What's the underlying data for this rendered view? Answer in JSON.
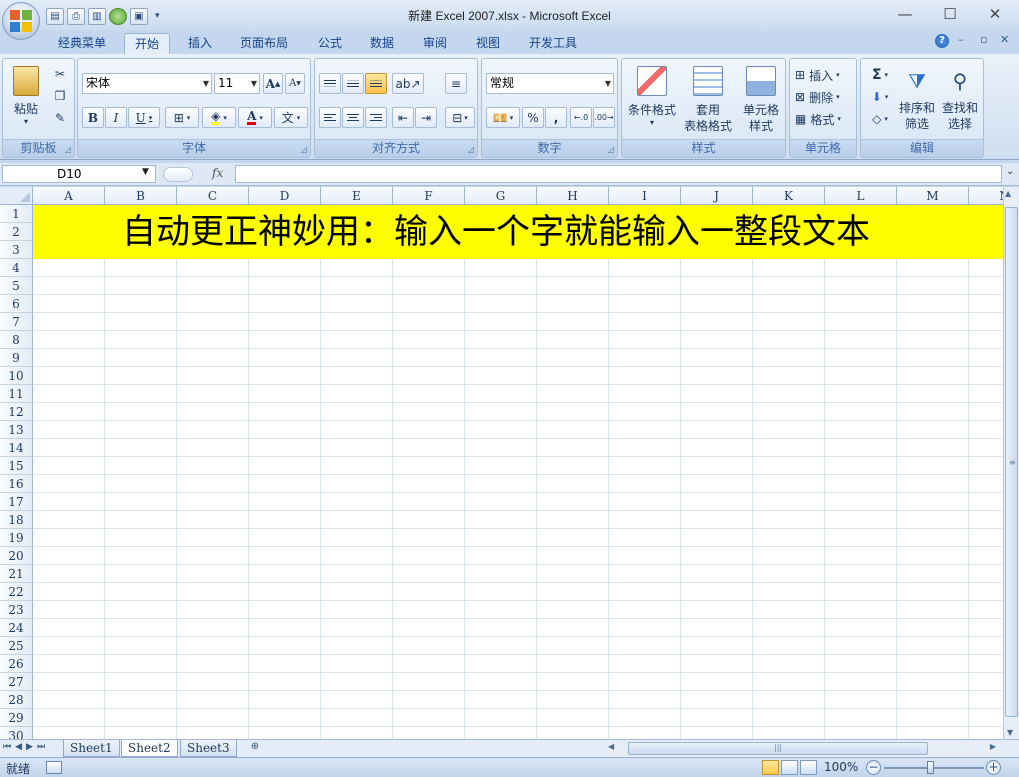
{
  "window": {
    "title": "新建 Excel 2007.xlsx - Microsoft Excel",
    "minimize": "—",
    "maximize": "☐",
    "close": "✕"
  },
  "quick_access": {
    "icons": [
      "print-preview-icon",
      "print-icon",
      "chart-icon",
      "circle-icon",
      "save-icon"
    ],
    "dropdown": "▾"
  },
  "tabs": [
    {
      "label": "经典菜单",
      "active": false
    },
    {
      "label": "开始",
      "active": true
    },
    {
      "label": "插入",
      "active": false
    },
    {
      "label": "页面布局",
      "active": false
    },
    {
      "label": "公式",
      "active": false
    },
    {
      "label": "数据",
      "active": false
    },
    {
      "label": "审阅",
      "active": false
    },
    {
      "label": "视图",
      "active": false
    },
    {
      "label": "开发工具",
      "active": false
    }
  ],
  "ribbon": {
    "clipboard": {
      "label": "剪贴板",
      "paste": "粘贴"
    },
    "font": {
      "label": "字体",
      "font_name": "宋体",
      "font_size": "11",
      "bold": "B",
      "italic": "I",
      "underline": "U",
      "grow": "A",
      "shrink": "A",
      "font_color_letter": "A",
      "phonetic": "文"
    },
    "alignment": {
      "label": "对齐方式"
    },
    "number": {
      "label": "数字",
      "format": "常规",
      "percent": "%",
      "comma": ","
    },
    "styles": {
      "label": "样式",
      "conditional": "条件格式",
      "table_format_1": "套用",
      "table_format_2": "表格格式",
      "cell_styles_1": "单元格",
      "cell_styles_2": "样式"
    },
    "cells": {
      "label": "单元格",
      "insert": "插入",
      "delete": "删除",
      "format": "格式"
    },
    "editing": {
      "label": "编辑",
      "sort_1": "排序和",
      "sort_2": "筛选",
      "find_1": "查找和",
      "find_2": "选择",
      "sum": "Σ"
    }
  },
  "formula_bar": {
    "name_box": "D10",
    "fx": "fx",
    "value": ""
  },
  "grid": {
    "columns": [
      "A",
      "B",
      "C",
      "D",
      "E",
      "F",
      "G",
      "H",
      "I",
      "J",
      "K",
      "L",
      "M",
      "N"
    ],
    "rows": [
      "1",
      "2",
      "3",
      "4",
      "5",
      "6",
      "7",
      "8",
      "9",
      "10",
      "11",
      "12",
      "13",
      "14",
      "15",
      "16",
      "17",
      "18",
      "19",
      "20",
      "21",
      "22",
      "23",
      "24",
      "25",
      "26",
      "27",
      "28",
      "29",
      "30"
    ],
    "banner_text": "自动更正神妙用：输入一个字就能输入一整段文本",
    "banner_color": "#ffff00"
  },
  "sheets": [
    {
      "label": "Sheet1",
      "active": false
    },
    {
      "label": "Sheet2",
      "active": true
    },
    {
      "label": "Sheet3",
      "active": false
    }
  ],
  "status": {
    "ready": "就绪",
    "zoom": "100%",
    "zoom_level_percent": 100,
    "zoom_out": "−",
    "zoom_in": "+"
  }
}
